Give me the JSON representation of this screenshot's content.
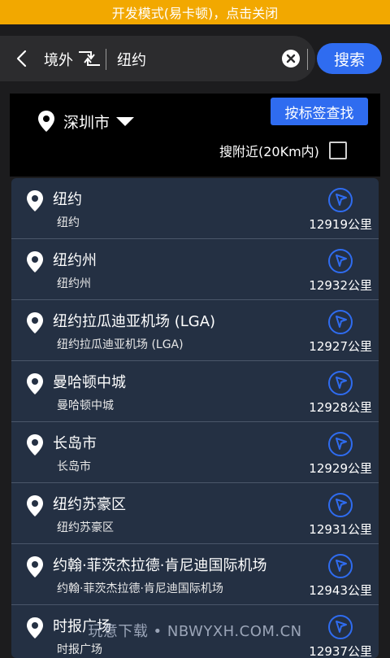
{
  "devbar": {
    "text": "开发模式(易卡顿)，点击关闭"
  },
  "search": {
    "scope_label": "境外",
    "query": "纽约",
    "button_label": "搜索"
  },
  "filter": {
    "city": "深圳市",
    "tag_button": "按标签查找",
    "nearby_label": "搜附近(20Km内)",
    "nearby_checked": false
  },
  "results": [
    {
      "name": "纽约",
      "sub": "纽约",
      "distance": "12919公里"
    },
    {
      "name": "纽约州",
      "sub": "纽约州",
      "distance": "12932公里"
    },
    {
      "name": "纽约拉瓜迪亚机场 (LGA)",
      "sub": "纽约拉瓜迪亚机场 (LGA)",
      "distance": "12927公里"
    },
    {
      "name": "曼哈顿中城",
      "sub": "曼哈顿中城",
      "distance": "12928公里"
    },
    {
      "name": "长岛市",
      "sub": "长岛市",
      "distance": "12929公里"
    },
    {
      "name": "纽约苏豪区",
      "sub": "纽约苏豪区",
      "distance": "12931公里"
    },
    {
      "name": "约翰·菲茨杰拉德·肯尼迪国际机场",
      "sub": "约翰·菲茨杰拉德·肯尼迪国际机场",
      "distance": "12943公里"
    },
    {
      "name": "时报广场",
      "sub": "时报广场",
      "distance": "12937公里"
    }
  ],
  "watermark": "玩意下载 • NBWYXH.COM.CN",
  "colors": {
    "accent": "#2f6cf0",
    "devbar": "#f2a800",
    "list_bg": "#243043"
  }
}
